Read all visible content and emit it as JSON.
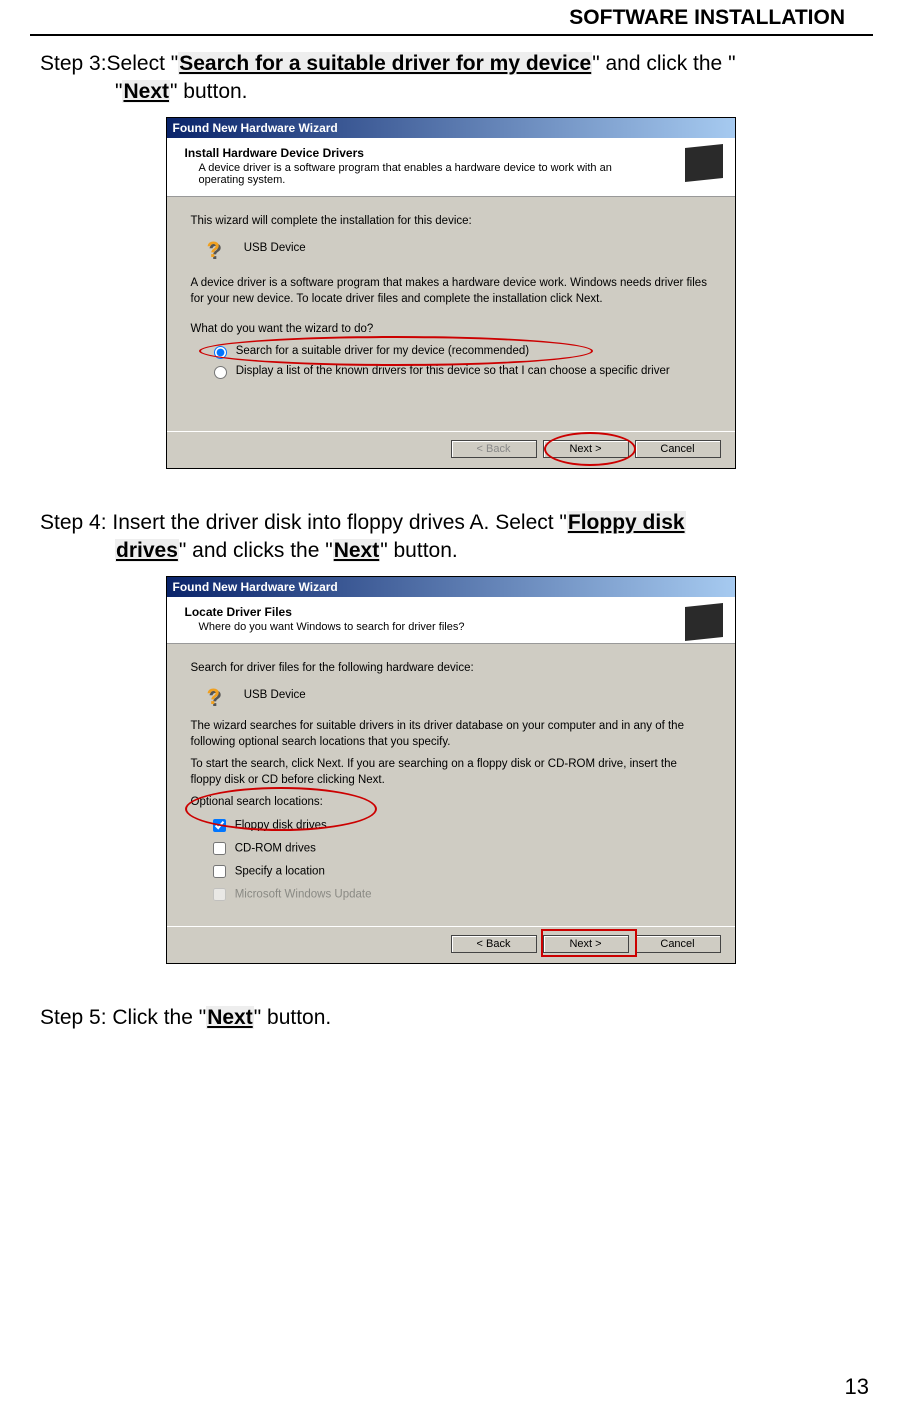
{
  "header": "SOFTWARE INSTALLATION",
  "page_number": "13",
  "step3": {
    "pre": "Step 3:Select \"",
    "highlight1": "Search for a suitable driver for my device",
    "mid": "\" and click the \"",
    "highlight2": "Next",
    "post": "\" button."
  },
  "step4": {
    "pre": "Step 4: Insert the driver disk into floppy drives A. Select \"",
    "highlight1": "Floppy disk drives",
    "mid": "\" and clicks the \"",
    "highlight2": "Next",
    "post": "\" button."
  },
  "step5": {
    "pre": "Step 5: Click the \"",
    "highlight1": "Next",
    "post": "\" button."
  },
  "wizard1": {
    "title": "Found New Hardware Wizard",
    "heading": "Install Hardware Device Drivers",
    "subheading": "A device driver is a software program that enables a hardware device to work with an operating system.",
    "intro": "This wizard will complete the installation for this device:",
    "device": "USB Device",
    "desc": "A device driver is a software program that makes a hardware device work. Windows needs driver files for your new device. To locate driver files and complete the installation click Next.",
    "question": "What do you want the wizard to do?",
    "radio1": "Search for a suitable driver for my device (recommended)",
    "radio2": "Display a list of the known drivers for this device so that I can choose a specific driver",
    "buttons": {
      "back": "< Back",
      "next": "Next >",
      "cancel": "Cancel"
    }
  },
  "wizard2": {
    "title": "Found New Hardware Wizard",
    "heading": "Locate Driver Files",
    "subheading": "Where do you want Windows to search for driver files?",
    "intro": "Search for driver files for the following hardware device:",
    "device": "USB Device",
    "desc1": "The wizard searches for suitable drivers in its driver database on your computer and in any of the following optional search locations that you specify.",
    "desc2": "To start the search, click Next. If you are searching on a floppy disk or CD-ROM drive, insert the floppy disk or CD before clicking Next.",
    "opt_label": "Optional search locations:",
    "check1": "Floppy disk drives",
    "check2": "CD-ROM drives",
    "check3": "Specify a location",
    "check4": "Microsoft Windows Update",
    "buttons": {
      "back": "< Back",
      "next": "Next >",
      "cancel": "Cancel"
    }
  }
}
